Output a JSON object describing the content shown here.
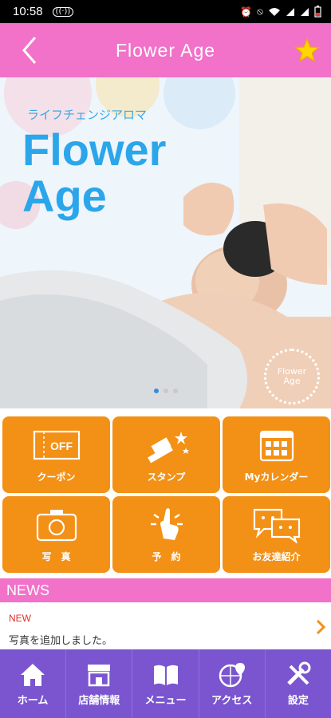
{
  "status": {
    "time": "10:58",
    "rec_icon": "radio-icon",
    "icons": [
      "alarm-icon",
      "mute-icon",
      "wifi-icon",
      "signal-icon",
      "signal-icon",
      "battery-icon"
    ]
  },
  "appbar": {
    "title": "Flower Age",
    "back_icon": "back-chevron-icon",
    "fav_icon": "star-icon",
    "accent": "#f172c8"
  },
  "hero": {
    "subtitle": "ライフチェンジアロマ",
    "title_line1": "Flower",
    "title_line2": "Age",
    "logo_line1": "Flower",
    "logo_line2": "Age",
    "slide_count": 3,
    "active_slide": 1
  },
  "menu": {
    "tile_color": "#f39016",
    "items": [
      {
        "label": "クーポン",
        "icon": "coupon-icon",
        "icon_text": "OFF"
      },
      {
        "label": "スタンプ",
        "icon": "stamp-icon"
      },
      {
        "label": "Myカレンダー",
        "icon": "calendar-icon"
      },
      {
        "label": "写　真",
        "icon": "camera-icon"
      },
      {
        "label": "予　約",
        "icon": "tap-icon"
      },
      {
        "label": "お友達紹介",
        "icon": "chat-icon"
      }
    ]
  },
  "news": {
    "heading": "NEWS",
    "items": [
      {
        "badge": "NEW",
        "text": "写真を追加しました。"
      }
    ]
  },
  "nav": {
    "color": "#7a55cf",
    "items": [
      {
        "label": "ホーム",
        "icon": "home-icon"
      },
      {
        "label": "店舗情報",
        "icon": "store-icon"
      },
      {
        "label": "メニュー",
        "icon": "book-icon"
      },
      {
        "label": "アクセス",
        "icon": "map-pin-icon"
      },
      {
        "label": "設定",
        "icon": "settings-tools-icon"
      }
    ]
  }
}
